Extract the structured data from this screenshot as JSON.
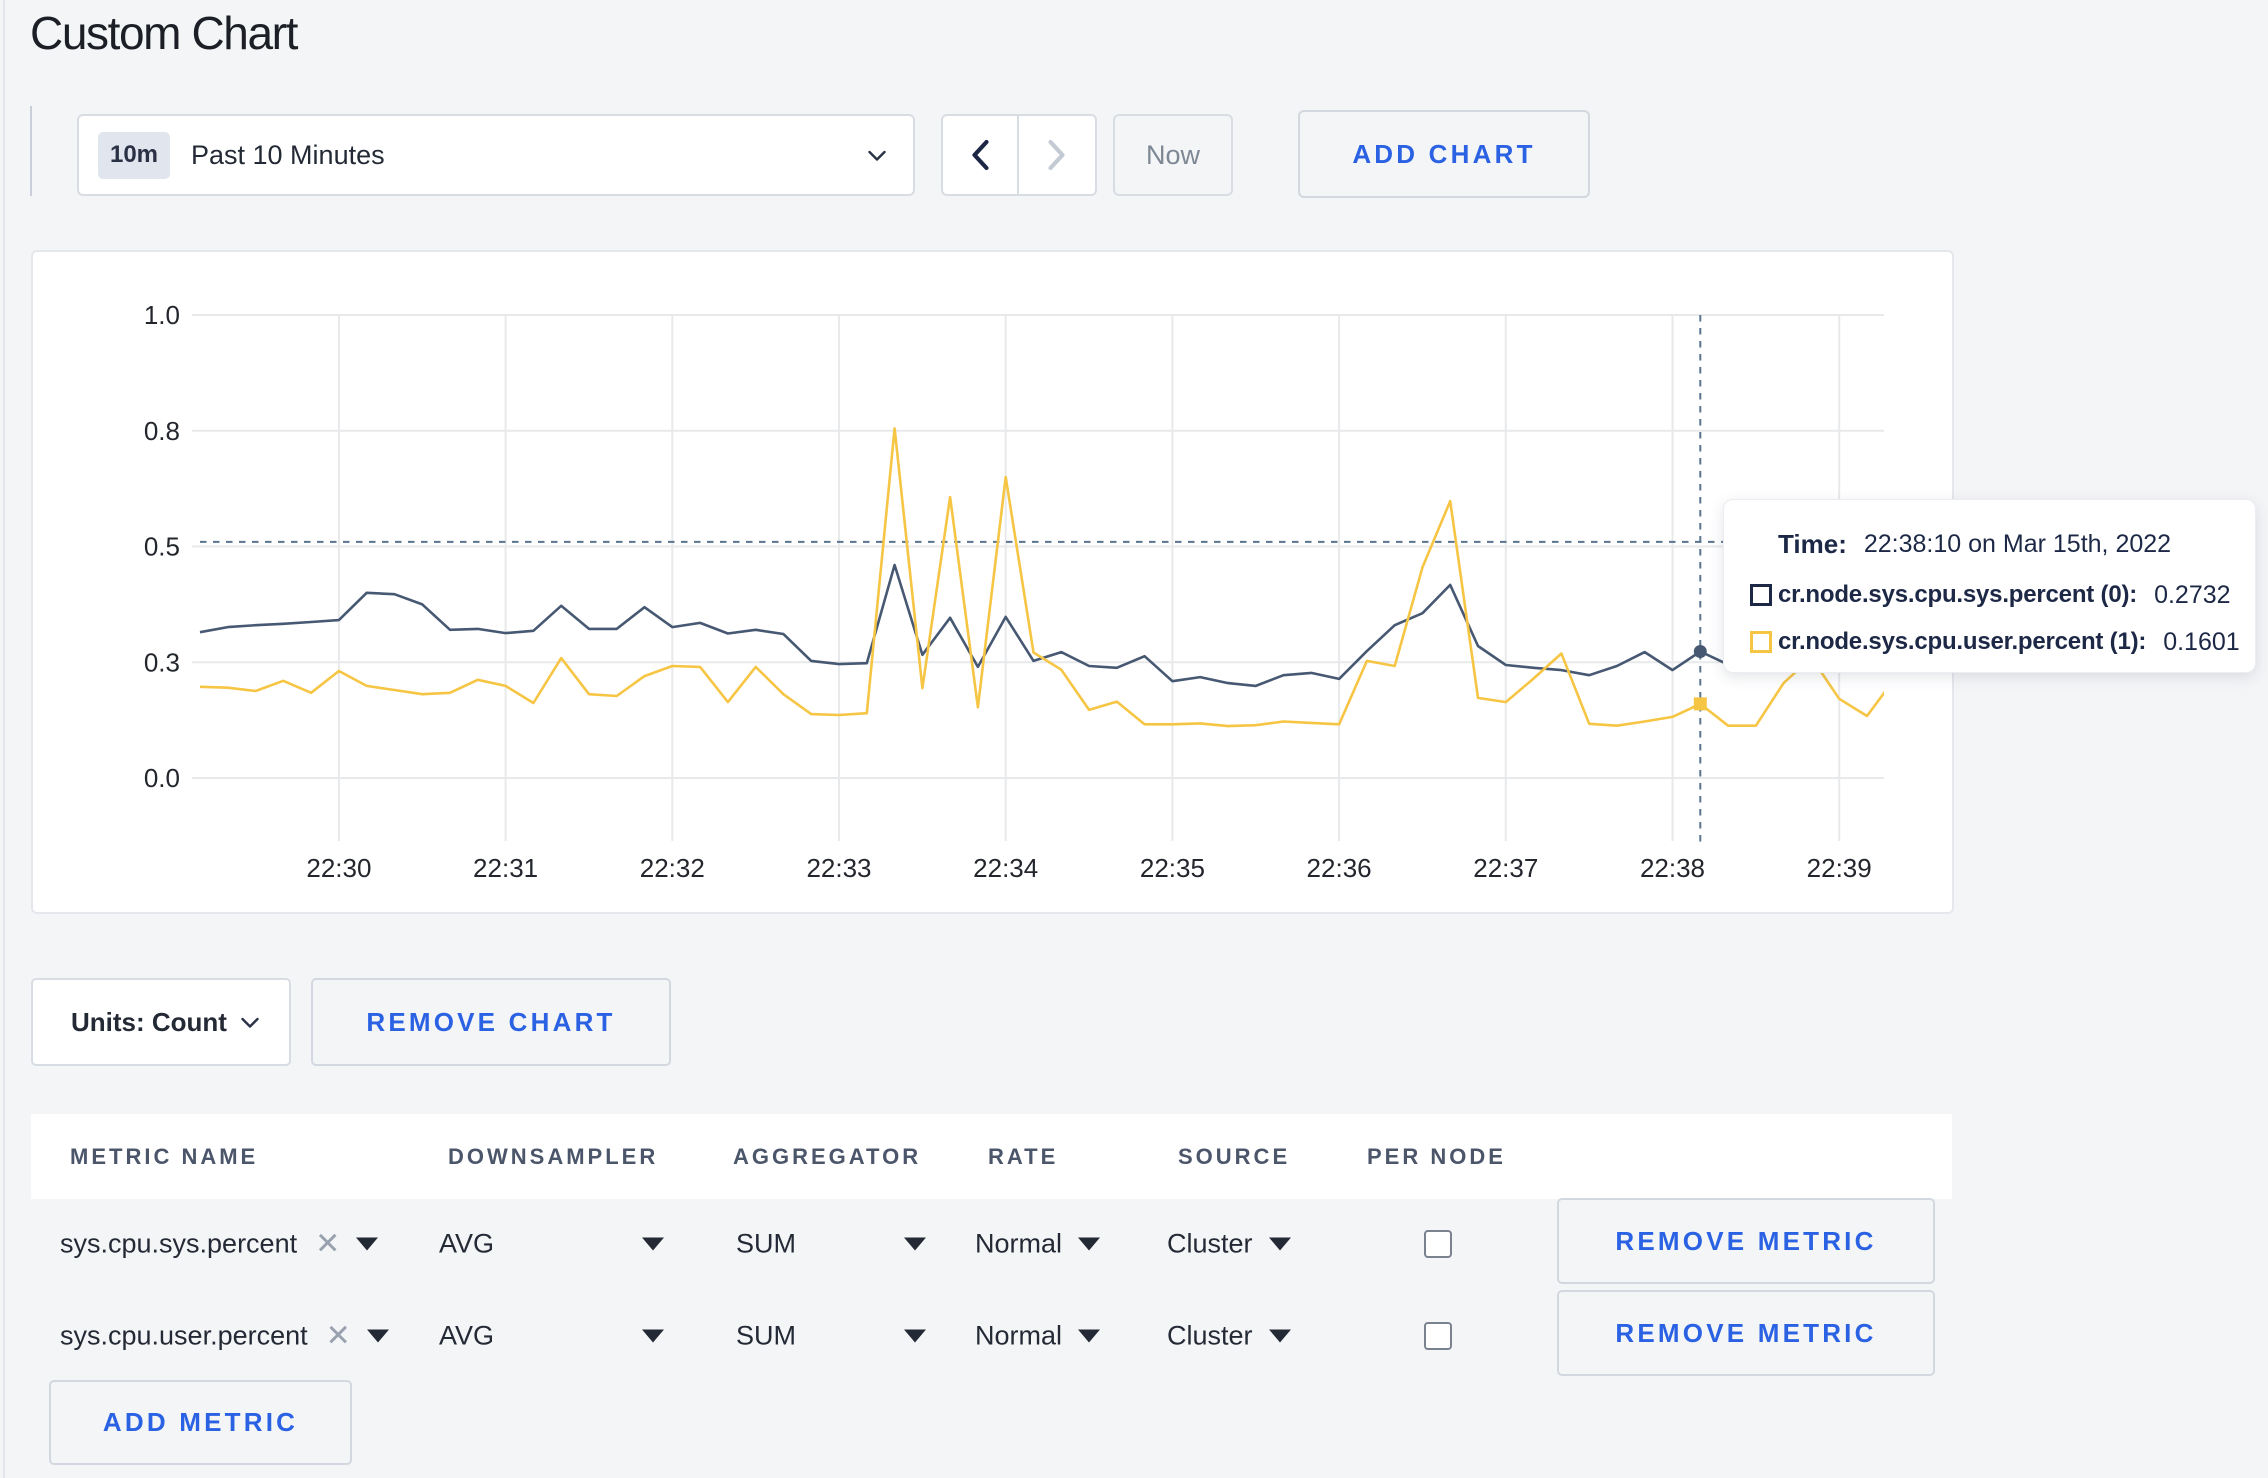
{
  "page": {
    "title": "Custom Chart"
  },
  "toolbar": {
    "range_badge": "10m",
    "range_label": "Past 10 Minutes",
    "now_label": "Now",
    "add_chart_label": "ADD CHART"
  },
  "chart_data": {
    "type": "line",
    "title": "",
    "xlabel": "",
    "ylabel": "",
    "ylim": [
      0,
      1
    ],
    "grid": true,
    "x_start": "22:29:10",
    "x_interval_seconds": 10,
    "x_ticks": [
      "22:30",
      "22:31",
      "22:32",
      "22:33",
      "22:34",
      "22:35",
      "22:36",
      "22:37",
      "22:38",
      "22:39"
    ],
    "y_ticks": [
      {
        "value": 0.0,
        "label": "0.0"
      },
      {
        "value": 0.25,
        "label": "0.3"
      },
      {
        "value": 0.5,
        "label": "0.5"
      },
      {
        "value": 0.75,
        "label": "0.8"
      },
      {
        "value": 1.0,
        "label": "1.0"
      }
    ],
    "series": [
      {
        "name": "cr.node.sys.cpu.sys.percent",
        "color": "#475872",
        "marker": "circle",
        "values": [
          0.315,
          0.326,
          0.33,
          0.333,
          0.337,
          0.341,
          0.4,
          0.397,
          0.375,
          0.32,
          0.322,
          0.313,
          0.318,
          0.372,
          0.322,
          0.322,
          0.369,
          0.326,
          0.335,
          0.312,
          0.32,
          0.311,
          0.253,
          0.246,
          0.248,
          0.46,
          0.266,
          0.346,
          0.24,
          0.348,
          0.253,
          0.272,
          0.242,
          0.238,
          0.263,
          0.209,
          0.218,
          0.205,
          0.199,
          0.222,
          0.227,
          0.214,
          0.274,
          0.33,
          0.356,
          0.417,
          0.285,
          0.244,
          0.238,
          0.233,
          0.222,
          0.242,
          0.272,
          0.233,
          0.2732,
          0.245,
          0.252,
          0.244,
          0.258,
          0.27,
          0.262,
          0.27
        ]
      },
      {
        "name": "cr.node.sys.cpu.user.percent",
        "color": "#F6C544",
        "marker": "square",
        "values": [
          0.197,
          0.195,
          0.188,
          0.21,
          0.184,
          0.231,
          0.199,
          0.19,
          0.181,
          0.184,
          0.212,
          0.199,
          0.162,
          0.259,
          0.181,
          0.177,
          0.22,
          0.242,
          0.24,
          0.164,
          0.24,
          0.181,
          0.138,
          0.136,
          0.14,
          0.755,
          0.194,
          0.607,
          0.153,
          0.65,
          0.271,
          0.234,
          0.147,
          0.165,
          0.116,
          0.116,
          0.118,
          0.112,
          0.114,
          0.122,
          0.119,
          0.116,
          0.253,
          0.242,
          0.455,
          0.598,
          0.173,
          0.164,
          0.215,
          0.269,
          0.117,
          0.113,
          0.122,
          0.132,
          0.1601,
          0.113,
          0.113,
          0.205,
          0.26,
          0.171,
          0.134,
          0.215
        ]
      }
    ],
    "hover": {
      "index": 54,
      "crosshair_value": 0.51
    }
  },
  "tooltip": {
    "time_label": "Time:",
    "time_value": "22:38:10 on Mar 15th, 2022",
    "entries": [
      {
        "label": "cr.node.sys.cpu.sys.percent (0):",
        "value": "0.2732",
        "color": "#1C2845"
      },
      {
        "label": "cr.node.sys.cpu.user.percent (1):",
        "value": "0.1601",
        "color": "#F6C544"
      }
    ]
  },
  "units_bar": {
    "units_label": "Units: Count",
    "remove_chart_label": "REMOVE CHART"
  },
  "metrics_table": {
    "columns": [
      "METRIC NAME",
      "DOWNSAMPLER",
      "AGGREGATOR",
      "RATE",
      "SOURCE",
      "PER NODE"
    ],
    "add_metric_label": "ADD METRIC",
    "rows": [
      {
        "metric": "sys.cpu.sys.percent",
        "downsampler": "AVG",
        "aggregator": "SUM",
        "rate": "Normal",
        "source": "Cluster",
        "per_node": false,
        "remove_label": "REMOVE METRIC"
      },
      {
        "metric": "sys.cpu.user.percent",
        "downsampler": "AVG",
        "aggregator": "SUM",
        "rate": "Normal",
        "source": "Cluster",
        "per_node": false,
        "remove_label": "REMOVE METRIC"
      }
    ]
  }
}
